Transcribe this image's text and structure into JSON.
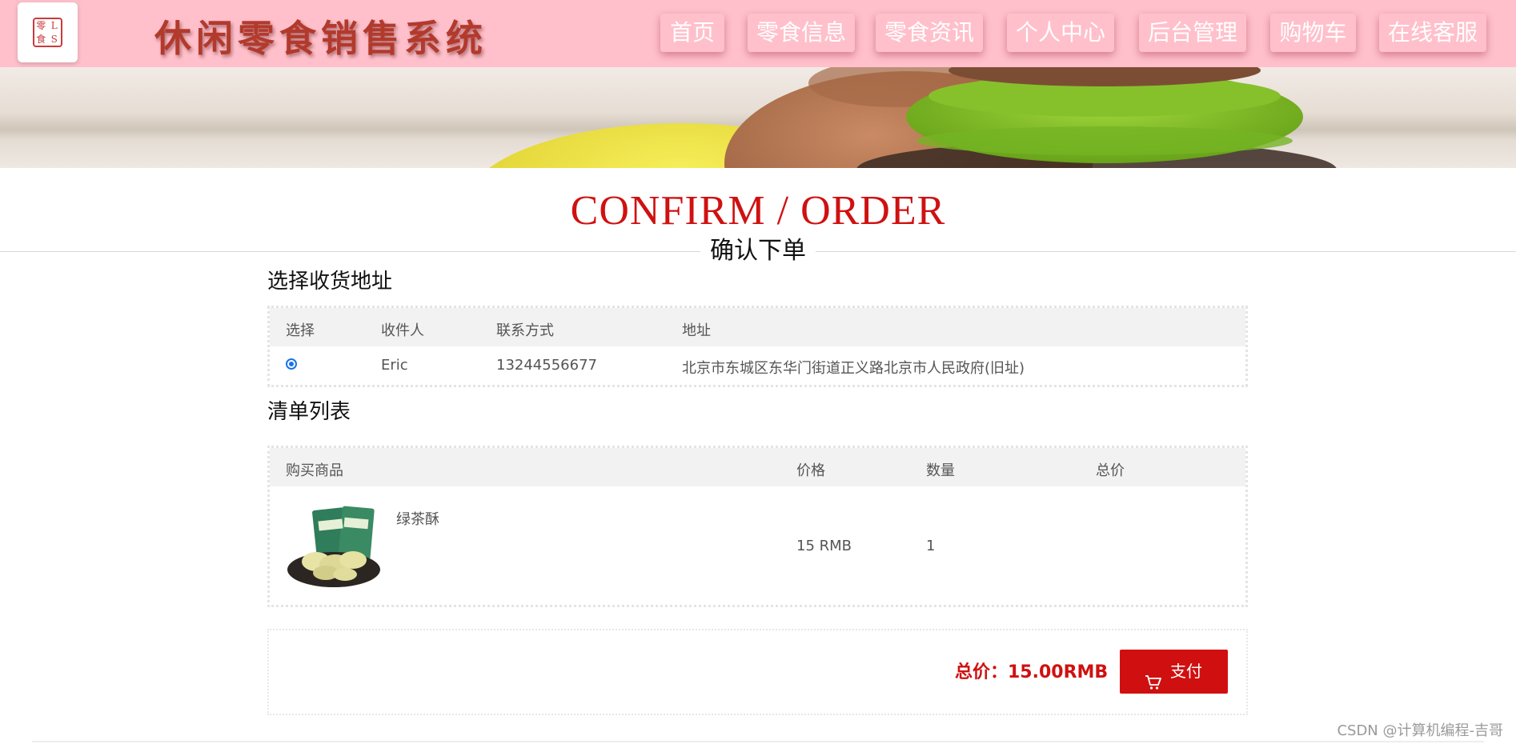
{
  "header": {
    "site_title": "休闲零食销售系统",
    "logo_chars": [
      "零",
      "L",
      "食",
      "S"
    ],
    "nav": [
      "首页",
      "零食信息",
      "零食资讯",
      "个人中心",
      "后台管理",
      "购物车",
      "在线客服"
    ]
  },
  "page": {
    "title_en": "CONFIRM / ORDER",
    "title_cn": "确认下单"
  },
  "address_section": {
    "title": "选择收货地址",
    "columns": [
      "选择",
      "收件人",
      "联系方式",
      "地址"
    ],
    "rows": [
      {
        "selected": true,
        "recipient": "Eric",
        "phone": "13244556677",
        "address": "北京市东城区东华门街道正义路北京市人民政府(旧址)"
      }
    ]
  },
  "order_section": {
    "title": "清单列表",
    "columns": [
      "购买商品",
      "价格",
      "数量",
      "总价"
    ],
    "items": [
      {
        "name": "绿茶酥",
        "price": "15 RMB",
        "quantity": "1",
        "subtotal": ""
      }
    ]
  },
  "summary": {
    "total_text": "总价：15.00RMB",
    "pay_label": "支付"
  },
  "footer": {
    "watermark": "CSDN @计算机编程-吉哥"
  },
  "colors": {
    "header_bg": "#ffc0cb",
    "accent_red": "#d01010",
    "title_red": "#cf1111",
    "site_title": "#b23a2c"
  },
  "icons": {
    "pay": "cart-icon",
    "logo": "seal-logo-icon"
  }
}
